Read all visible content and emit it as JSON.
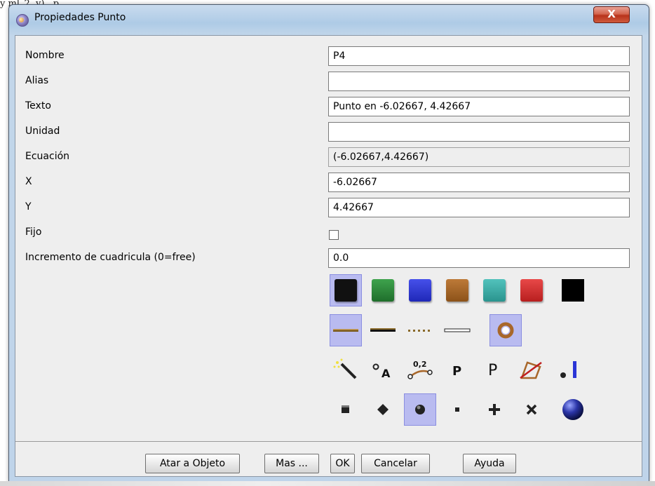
{
  "background": {
    "clipped_text": "y            ml_2, y) , p"
  },
  "window": {
    "title": "Propiedades Punto",
    "close_label": "X"
  },
  "fields": [
    {
      "label": "Nombre",
      "value": "P4",
      "readonly": false
    },
    {
      "label": "Alias",
      "value": "",
      "readonly": false
    },
    {
      "label": "Texto",
      "value": "Punto en -6.02667, 4.42667",
      "readonly": false
    },
    {
      "label": "Unidad",
      "value": "",
      "readonly": false
    },
    {
      "label": "Ecuación",
      "value": "(-6.02667,4.42667)",
      "readonly": true
    },
    {
      "label": "X",
      "value": "-6.02667",
      "readonly": false
    },
    {
      "label": "Y",
      "value": "4.42667",
      "readonly": false
    }
  ],
  "fixed": {
    "label": "Fijo",
    "checked": false
  },
  "grid_increment": {
    "label": "Incremento de cuadricula (0=free)",
    "value": "0.0"
  },
  "colors": [
    {
      "name": "black",
      "hex": "#111111",
      "selected": true
    },
    {
      "name": "green",
      "hex": "#2b8a3a",
      "selected": false
    },
    {
      "name": "blue",
      "hex": "#2b35d6",
      "selected": false
    },
    {
      "name": "brown",
      "hex": "#a8672a",
      "selected": false
    },
    {
      "name": "teal",
      "hex": "#3aaea8",
      "selected": false
    },
    {
      "name": "red",
      "hex": "#d83030",
      "selected": false
    },
    {
      "name": "solid-black",
      "hex": "#000000",
      "selected": false
    }
  ],
  "line_styles": [
    {
      "name": "normal-line",
      "selected": true
    },
    {
      "name": "thick-line",
      "selected": false
    },
    {
      "name": "dotted-line",
      "selected": false
    },
    {
      "name": "thin-line",
      "selected": false
    },
    {
      "name": "ring-style",
      "selected": true
    }
  ],
  "display_options": [
    {
      "name": "magic-wand-icon"
    },
    {
      "name": "point-label-a-icon",
      "text": "A"
    },
    {
      "name": "point-value-icon",
      "text": "0,2"
    },
    {
      "name": "large-p-label-icon",
      "text": "P"
    },
    {
      "name": "small-p-label-icon",
      "text": "P"
    },
    {
      "name": "transform-shape-icon"
    },
    {
      "name": "condition-icon"
    }
  ],
  "point_types": [
    {
      "name": "square-point-icon",
      "selected": false
    },
    {
      "name": "diamond-point-icon",
      "selected": false
    },
    {
      "name": "circle-point-icon",
      "selected": true
    },
    {
      "name": "dot-point-icon",
      "selected": false
    },
    {
      "name": "plus-point-icon",
      "selected": false
    },
    {
      "name": "cross-point-icon",
      "selected": false
    },
    {
      "name": "large-circle-point-icon",
      "selected": false
    }
  ],
  "buttons": {
    "bind": "Atar a Objeto",
    "more": "Mas ...",
    "ok": "OK",
    "cancel": "Cancelar",
    "help": "Ayuda"
  }
}
